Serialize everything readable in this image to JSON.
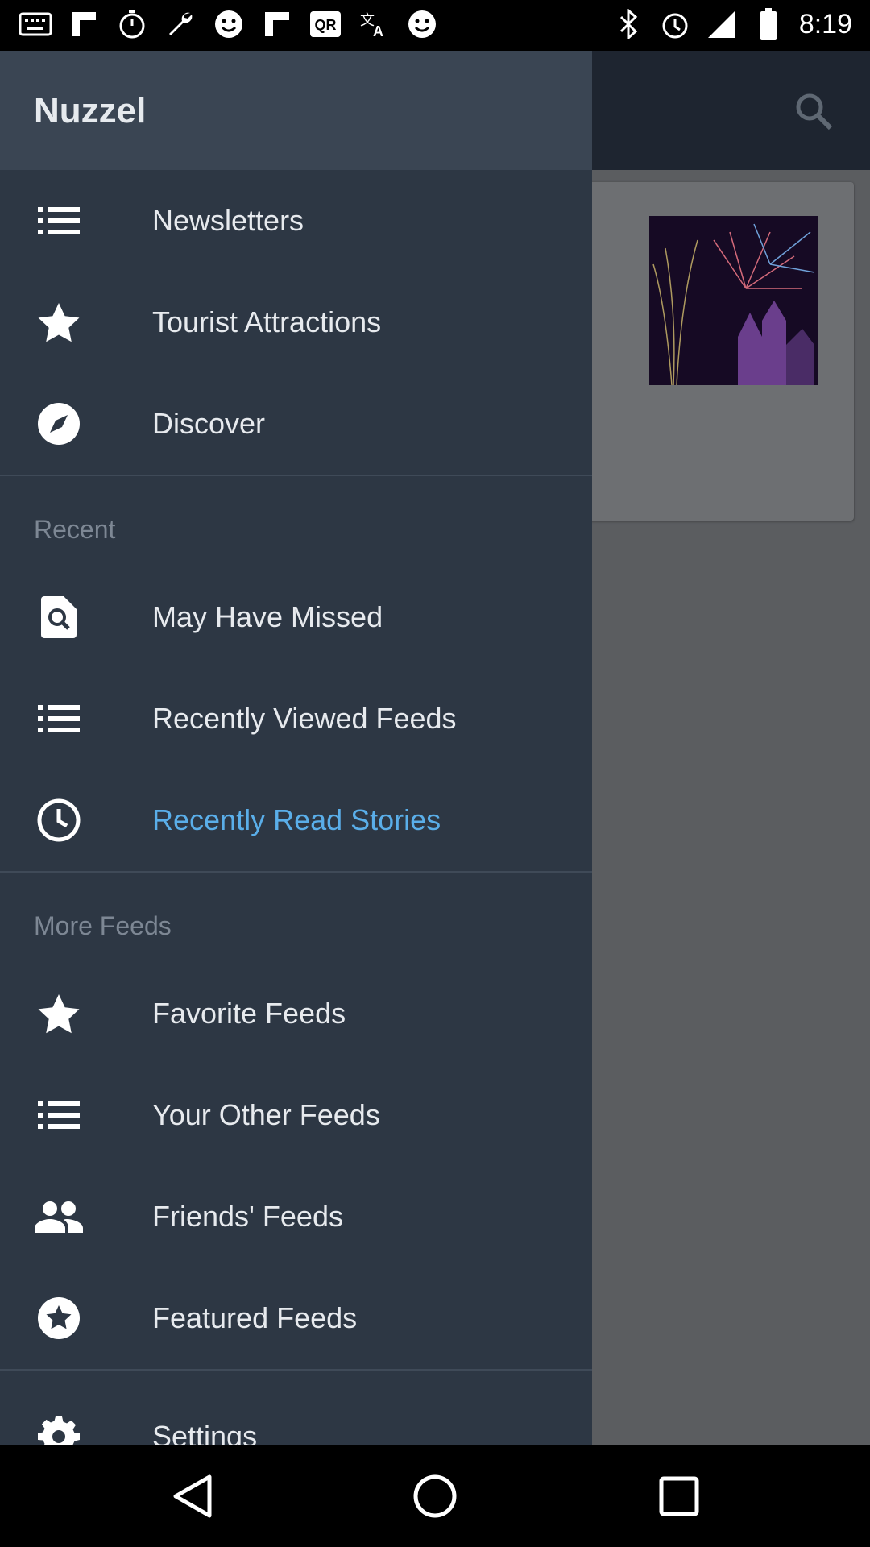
{
  "status_bar": {
    "time": "8:19",
    "left_icons": [
      "keyboard-icon",
      "flipboard-icon",
      "timer-icon",
      "wrench-icon",
      "smiley-icon",
      "flipboard-icon",
      "qr-icon",
      "translate-icon",
      "smiley-icon"
    ],
    "right_icons": [
      "bluetooth-icon",
      "alarm-icon",
      "signal-icon",
      "battery-icon"
    ]
  },
  "app": {
    "title": "Nuzzel",
    "search_icon": "search-icon"
  },
  "drawer": {
    "top_items": [
      {
        "label": "Newsletters",
        "icon": "list-icon"
      },
      {
        "label": "Tourist Attractions",
        "icon": "star-icon"
      },
      {
        "label": "Discover",
        "icon": "compass-icon"
      }
    ],
    "recent_title": "Recent",
    "recent_items": [
      {
        "label": "May Have Missed",
        "icon": "search-doc-icon"
      },
      {
        "label": "Recently Viewed Feeds",
        "icon": "list-icon"
      },
      {
        "label": "Recently Read Stories",
        "icon": "clock-icon",
        "active": true
      }
    ],
    "more_title": "More Feeds",
    "more_items": [
      {
        "label": "Favorite Feeds",
        "icon": "star-icon"
      },
      {
        "label": "Your Other Feeds",
        "icon": "list-icon"
      },
      {
        "label": "Friends' Feeds",
        "icon": "people-icon"
      },
      {
        "label": "Featured Feeds",
        "icon": "star-circle-icon"
      }
    ],
    "settings": {
      "label": "Settings",
      "icon": "gear-icon"
    }
  },
  "colors": {
    "drawer_bg": "#2d3744",
    "drawer_header_bg": "#3a4553",
    "active_text": "#5aaee9",
    "text": "#e7eaee"
  },
  "nav_bar": {
    "back": "back-icon",
    "home": "home-icon",
    "recents": "recents-icon"
  }
}
